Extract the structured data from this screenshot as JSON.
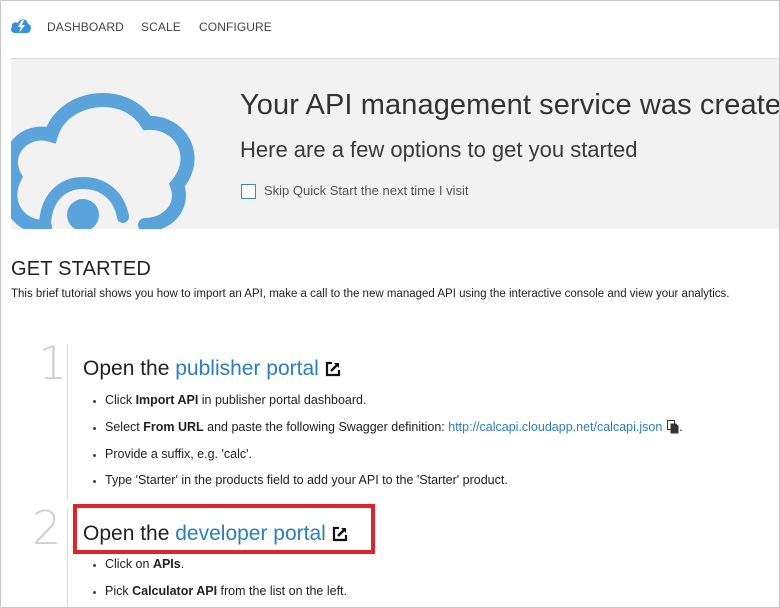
{
  "nav": {
    "items": [
      "DASHBOARD",
      "SCALE",
      "CONFIGURE"
    ]
  },
  "banner": {
    "title": "Your API management service was created",
    "subtitle": "Here are a few options to get you started",
    "skip_label": "Skip Quick Start the next time I visit"
  },
  "get_started": {
    "title": "GET STARTED",
    "description": "This brief tutorial shows you how to import an API, make a call to the new managed API using the interactive console and view your analytics."
  },
  "steps": [
    {
      "number": "1",
      "heading_prefix": "Open the ",
      "heading_link": "publisher portal",
      "bullets": [
        {
          "pre": "Click ",
          "bold": "Import API",
          "post": " in publisher portal dashboard."
        },
        {
          "pre": "Select ",
          "bold": "From URL",
          "post": " and paste the following Swagger definition: ",
          "url": "http://calcapi.cloudapp.net/calcapi.json",
          "tail": "."
        },
        {
          "text": "Provide a suffix, e.g. 'calc'."
        },
        {
          "text": "Type 'Starter' in the products field to add your API to the 'Starter' product."
        }
      ]
    },
    {
      "number": "2",
      "heading_prefix": "Open the ",
      "heading_link": "developer portal",
      "bullets": [
        {
          "pre": "Click on ",
          "bold": "APIs",
          "post": "."
        },
        {
          "pre": "Pick ",
          "bold": "Calculator API",
          "post": " from the list on the left."
        }
      ]
    }
  ],
  "colors": {
    "accent": "#2a7ec0",
    "cloud": "#5aa3db",
    "banner_bg": "#f2f2f2",
    "highlight": "#e0222b"
  },
  "icons": [
    "azure-logo-icon",
    "cloud-icon",
    "external-link-icon",
    "copy-icon"
  ]
}
